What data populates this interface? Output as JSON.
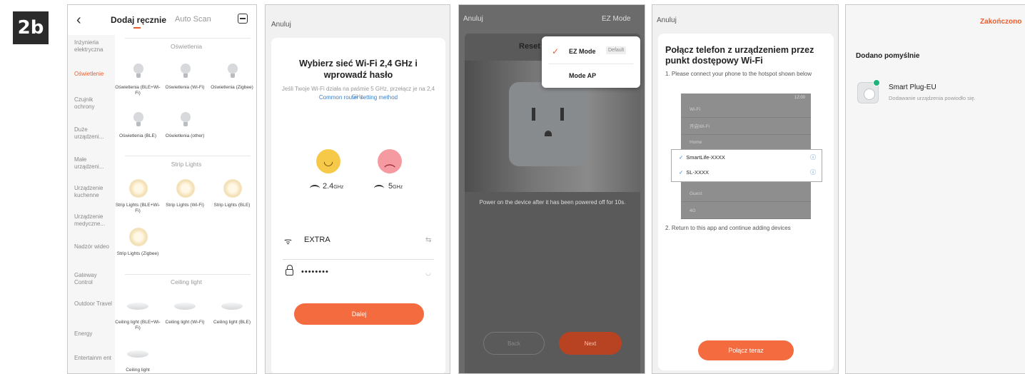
{
  "figure_label": "2b",
  "screen1": {
    "back_icon": "chevron-left-icon",
    "tab_active": "Dodaj ręcznie",
    "tab_inactive": "Auto Scan",
    "scan_icon": "scan-icon",
    "sidebar": [
      "Inżynieria elektryczna",
      "Oświetlenie",
      "Czujnik ochrony",
      "Duże urządzeni...",
      "Małe urządzeni...",
      "Urządzenie kuchenne",
      "Urządzenie medyczne...",
      "Nadzór wideo",
      "Gateway Control",
      "Outdoor Travel",
      "Energy",
      "Entertainm ent"
    ],
    "active_sidebar_index": 1,
    "section_lighting": "Oświetlenia",
    "lighting_devices": [
      "Oświetlenia (BLE+Wi-Fi)",
      "Oświetlenia (Wi-Fi)",
      "Oświetlenia (Zigbee)",
      "Oświetlenia (BLE)",
      "Oświetlenia (other)"
    ],
    "section_strip": "Strip Lights",
    "strip_devices": [
      "Strip Lights (BLE+Wi-Fi)",
      "Strip Lights (Wi-Fi)",
      "Strip Lights (BLE)",
      "Strip Lights (Zigbee)"
    ],
    "section_ceiling": "Ceiling light",
    "ceiling_devices": [
      "Ceiling light (BLE+Wi-Fi)",
      "Ceiling light (Wi-Fi)",
      "Ceiling light (BLE)",
      "Ceiling light"
    ]
  },
  "screen2": {
    "cancel": "Anuluj",
    "title": "Wybierz sieć Wi-Fi 2,4 GHz i wprowadź hasło",
    "subtitle": "Jeśli Twoje Wi-Fi działa na paśmie 5 GHz, przełącz je na 2,4 GHz.",
    "link": "Common router setting method",
    "band_24_num": "2.4",
    "band_24_unit": "GHz",
    "band_5_num": "5",
    "band_5_unit": "GHz",
    "ssid": "EXTRA",
    "password_mask": "••••••••",
    "next_button": "Dalej"
  },
  "screen3": {
    "cancel": "Anuluj",
    "mode_label": "EZ Mode",
    "heading": "Reset",
    "message": "Power on the device after it has been powered off for 10s.",
    "back_button": "Back",
    "next_button": "Next",
    "dropdown": {
      "ez_mode": "EZ Mode",
      "default_tag": "Default",
      "ap_mode": "Mode AP"
    }
  },
  "screen4": {
    "cancel": "Anuluj",
    "title": "Połącz telefon z urządzeniem przez punkt dostępowy Wi-Fi",
    "step1": "1. Please connect your phone to the hotspot shown below",
    "phone_time": "12:00",
    "phone_header": "Wi-Fi",
    "phone_rows": [
      "开启Wi-Fi",
      "Home",
      "Guest",
      "4G"
    ],
    "hotspots": [
      "SmartLife-XXXX",
      "SL-XXXX"
    ],
    "step2": "2. Return to this app and continue adding devices",
    "connect_button": "Połącz teraz"
  },
  "screen5": {
    "done": "Zakończono",
    "success_title": "Dodano pomyślnie",
    "device_name": "Smart Plug-EU",
    "device_desc": "Dodawanie urządzenia powiodło się."
  },
  "colors": {
    "accent": "#f36b3f",
    "link": "#3c7fc6",
    "success": "#1fb37c"
  }
}
